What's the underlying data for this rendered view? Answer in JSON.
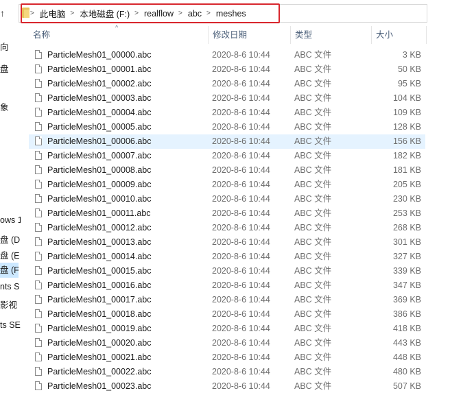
{
  "breadcrumb": [
    "此电脑",
    "本地磁盘 (F:)",
    "realflow",
    "abc",
    "meshes"
  ],
  "columns": {
    "name": "名称",
    "date": "修改日期",
    "type": "类型",
    "size": "大小"
  },
  "nav": {
    "items": [
      "向",
      "盘",
      "象",
      "ows 1",
      "盘 (D",
      "盘 (E",
      "盘 (F",
      "nts S",
      "影视",
      "ts SE"
    ]
  },
  "files": [
    {
      "name": "ParticleMesh01_00000.abc",
      "date": "2020-8-6 10:44",
      "type": "ABC 文件",
      "size": "3 KB"
    },
    {
      "name": "ParticleMesh01_00001.abc",
      "date": "2020-8-6 10:44",
      "type": "ABC 文件",
      "size": "50 KB"
    },
    {
      "name": "ParticleMesh01_00002.abc",
      "date": "2020-8-6 10:44",
      "type": "ABC 文件",
      "size": "95 KB"
    },
    {
      "name": "ParticleMesh01_00003.abc",
      "date": "2020-8-6 10:44",
      "type": "ABC 文件",
      "size": "104 KB"
    },
    {
      "name": "ParticleMesh01_00004.abc",
      "date": "2020-8-6 10:44",
      "type": "ABC 文件",
      "size": "109 KB"
    },
    {
      "name": "ParticleMesh01_00005.abc",
      "date": "2020-8-6 10:44",
      "type": "ABC 文件",
      "size": "128 KB"
    },
    {
      "name": "ParticleMesh01_00006.abc",
      "date": "2020-8-6 10:44",
      "type": "ABC 文件",
      "size": "156 KB"
    },
    {
      "name": "ParticleMesh01_00007.abc",
      "date": "2020-8-6 10:44",
      "type": "ABC 文件",
      "size": "182 KB"
    },
    {
      "name": "ParticleMesh01_00008.abc",
      "date": "2020-8-6 10:44",
      "type": "ABC 文件",
      "size": "181 KB"
    },
    {
      "name": "ParticleMesh01_00009.abc",
      "date": "2020-8-6 10:44",
      "type": "ABC 文件",
      "size": "205 KB"
    },
    {
      "name": "ParticleMesh01_00010.abc",
      "date": "2020-8-6 10:44",
      "type": "ABC 文件",
      "size": "230 KB"
    },
    {
      "name": "ParticleMesh01_00011.abc",
      "date": "2020-8-6 10:44",
      "type": "ABC 文件",
      "size": "253 KB"
    },
    {
      "name": "ParticleMesh01_00012.abc",
      "date": "2020-8-6 10:44",
      "type": "ABC 文件",
      "size": "268 KB"
    },
    {
      "name": "ParticleMesh01_00013.abc",
      "date": "2020-8-6 10:44",
      "type": "ABC 文件",
      "size": "301 KB"
    },
    {
      "name": "ParticleMesh01_00014.abc",
      "date": "2020-8-6 10:44",
      "type": "ABC 文件",
      "size": "327 KB"
    },
    {
      "name": "ParticleMesh01_00015.abc",
      "date": "2020-8-6 10:44",
      "type": "ABC 文件",
      "size": "339 KB"
    },
    {
      "name": "ParticleMesh01_00016.abc",
      "date": "2020-8-6 10:44",
      "type": "ABC 文件",
      "size": "347 KB"
    },
    {
      "name": "ParticleMesh01_00017.abc",
      "date": "2020-8-6 10:44",
      "type": "ABC 文件",
      "size": "369 KB"
    },
    {
      "name": "ParticleMesh01_00018.abc",
      "date": "2020-8-6 10:44",
      "type": "ABC 文件",
      "size": "386 KB"
    },
    {
      "name": "ParticleMesh01_00019.abc",
      "date": "2020-8-6 10:44",
      "type": "ABC 文件",
      "size": "418 KB"
    },
    {
      "name": "ParticleMesh01_00020.abc",
      "date": "2020-8-6 10:44",
      "type": "ABC 文件",
      "size": "443 KB"
    },
    {
      "name": "ParticleMesh01_00021.abc",
      "date": "2020-8-6 10:44",
      "type": "ABC 文件",
      "size": "448 KB"
    },
    {
      "name": "ParticleMesh01_00022.abc",
      "date": "2020-8-6 10:44",
      "type": "ABC 文件",
      "size": "480 KB"
    },
    {
      "name": "ParticleMesh01_00023.abc",
      "date": "2020-8-6 10:44",
      "type": "ABC 文件",
      "size": "507 KB"
    }
  ]
}
